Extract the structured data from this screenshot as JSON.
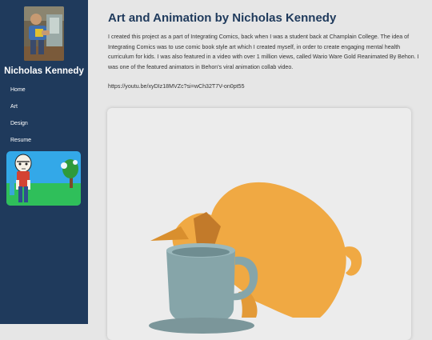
{
  "sidebar": {
    "name": "Nicholas Kennedy",
    "nav": [
      {
        "label": "Home"
      },
      {
        "label": "Art"
      },
      {
        "label": "Design"
      },
      {
        "label": "Resume"
      }
    ]
  },
  "main": {
    "title": "Art and Animation by Nicholas Kennedy",
    "description": "I created this project as a part of Integrating Comics, back when I was a student back at Champlain College. The idea of Integrating Comics was to use comic book style art which I created myself, in order to create engaging mental health curriculum for kids. I was also featured in a video with over 1 million views, called Wario Ware Gold Reanimated By Behon. I was one of the featured animators in Behon's viral animation collab video.",
    "link": "https://youtu.be/xyDIz18MVZc?si=wCh32T7V-on0pt55"
  },
  "colors": {
    "sidebar": "#1f3a5c",
    "title": "#1f3a5c",
    "page_background": "#e6e6e6",
    "cat": "#f0a943",
    "mug": "#86a5a9"
  }
}
